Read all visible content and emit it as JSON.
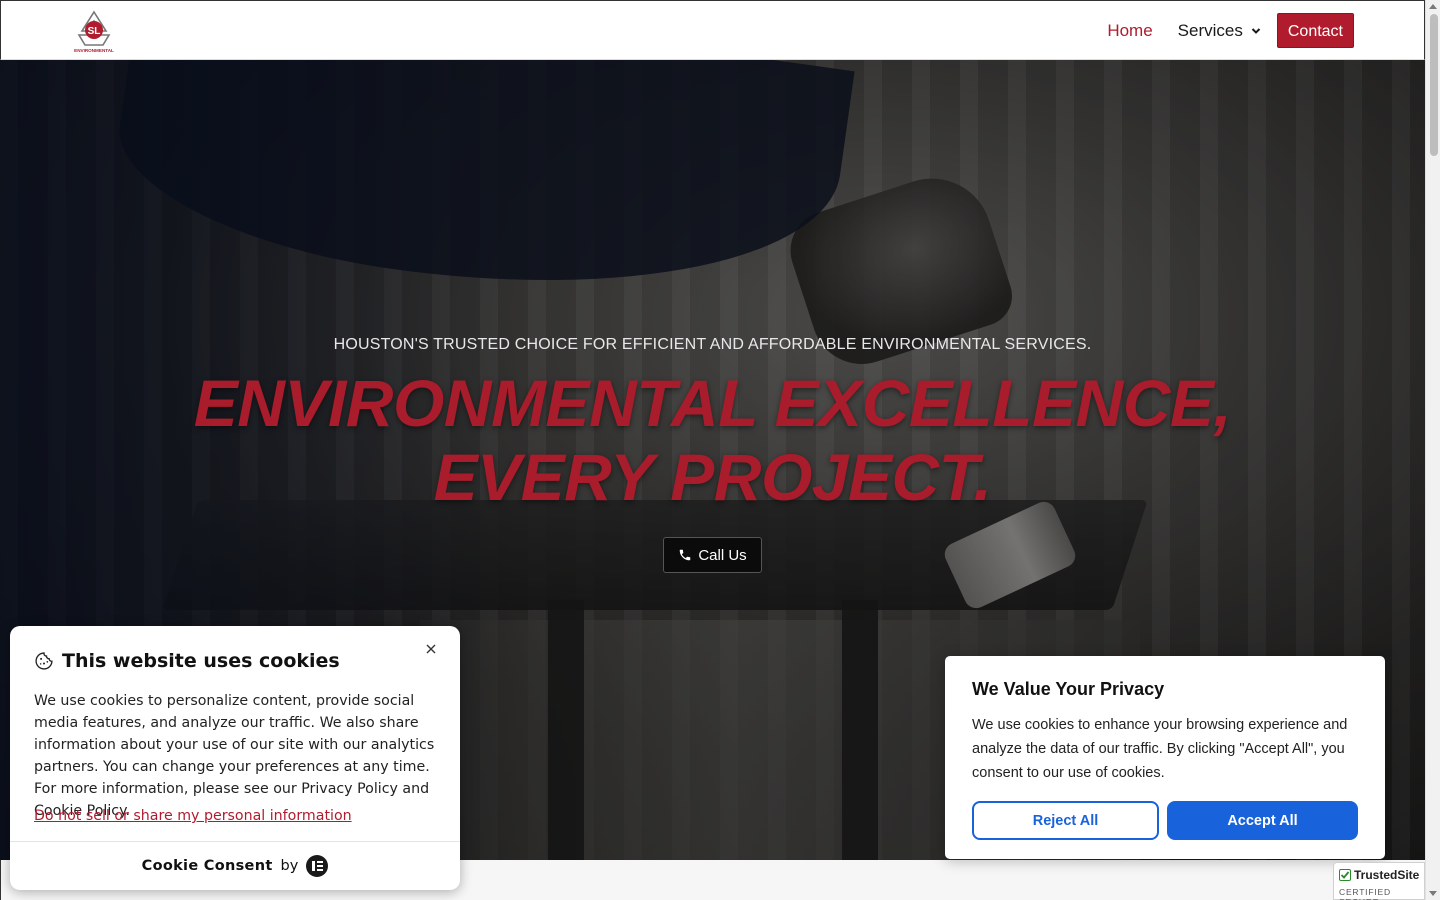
{
  "header": {
    "logo_text": "SL",
    "logo_subtext": "ENVIRONMENTAL",
    "nav": {
      "home": "Home",
      "services": "Services",
      "contact": "Contact"
    }
  },
  "hero": {
    "tagline": "HOUSTON'S TRUSTED CHOICE FOR EFFICIENT AND AFFORDABLE ENVIRONMENTAL SERVICES.",
    "headline_line1": "ENVIRONMENTAL EXCELLENCE,",
    "headline_line2": "EVERY PROJECT.",
    "cta_label": "Call Us",
    "cta_icon": "phone-icon"
  },
  "cookie_banner": {
    "title": "This website uses cookies",
    "body": "We use cookies to personalize content, provide social media features, and analyze our traffic. We also share information about your use of our site with our analytics partners. You can change your preferences at any time. For more information, please see our Privacy Policy and Cookie Policy.",
    "opt_out_link": "Do not sell or share my personal information",
    "footer_brand": "Cookie Consent",
    "footer_by": "by"
  },
  "privacy_notice": {
    "title": "We Value Your Privacy",
    "body": "We use cookies to enhance your browsing experience and analyze the data of our traffic. By clicking \"Accept All\", you consent to our use of cookies.",
    "reject_label": "Reject All",
    "accept_label": "Accept All"
  },
  "trust_badge": {
    "name": "TrustedSite",
    "subtitle": "CERTIFIED SECURE"
  },
  "colors": {
    "brand_red": "#b01c2e",
    "headline_red": "#a81c2c",
    "consent_blue": "#1863dc"
  }
}
